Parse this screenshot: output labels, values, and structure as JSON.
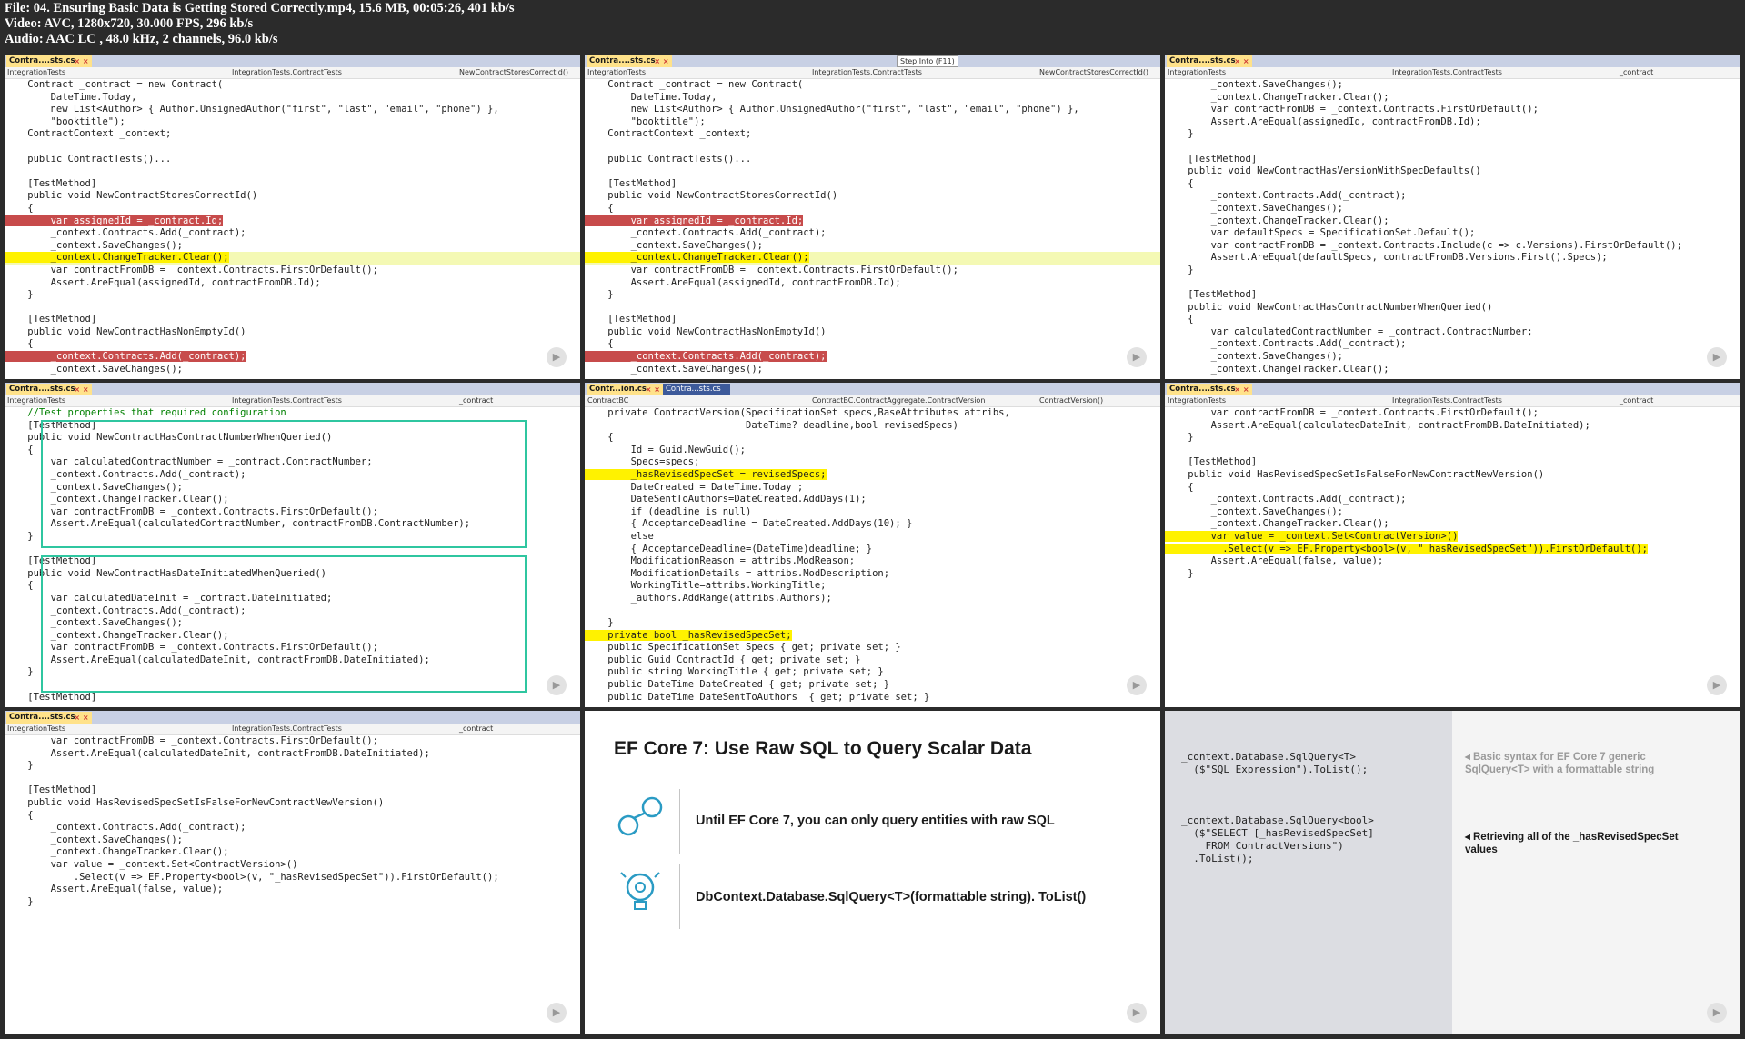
{
  "header": {
    "file": "File: 04. Ensuring Basic Data is Getting Stored Correctly.mp4, 15.6 MB, 00:05:26, 401 kb/s",
    "video": "Video: AVC, 1280x720, 30.000 FPS, 296 kb/s",
    "audio": "Audio: AAC LC , 48.0 kHz, 2 channels, 96.0 kb/s"
  },
  "panel1": {
    "tab": "Contra....sts.cs",
    "nav": [
      "IntegrationTests",
      "IntegrationTests.ContractTests",
      "NewContractStoresCorrectId()"
    ],
    "lines": [
      "    Contract _contract = new Contract(",
      "        DateTime.Today,",
      "        new List<Author> { Author.UnsignedAuthor(\"first\", \"last\", \"email\", \"phone\") },",
      "        \"booktitle\");",
      "    ContractContext _context;",
      "",
      "    public ContractTests()...",
      "",
      "    [TestMethod]",
      "    public void NewContractStoresCorrectId()",
      "    {",
      "        var assignedId = _contract.Id;",
      "        _context.Contracts.Add(_contract);",
      "        _context.SaveChanges();",
      "        _context.ChangeTracker.Clear();",
      "        var contractFromDB = _context.Contracts.FirstOrDefault();",
      "        Assert.AreEqual(assignedId, contractFromDB.Id);",
      "    }",
      "",
      "    [TestMethod]",
      "    public void NewContractHasNonEmptyId()",
      "    {",
      "        _context.Contracts.Add(_contract);",
      "        _context.SaveChanges();"
    ]
  },
  "panel2": {
    "tab": "Contra....sts.cs",
    "tooltip": "Step Into (F11)",
    "nav": [
      "IntegrationTests",
      "IntegrationTests.ContractTests",
      "NewContractStoresCorrectId()"
    ]
  },
  "panel3": {
    "tab": "Contra....sts.cs",
    "nav": [
      "IntegrationTests",
      "IntegrationTests.ContractTests",
      "_contract"
    ],
    "lines": [
      "        _context.SaveChanges();",
      "        _context.ChangeTracker.Clear();",
      "        var contractFromDB = _context.Contracts.FirstOrDefault();",
      "        Assert.AreEqual(assignedId, contractFromDB.Id);",
      "    }",
      "",
      "    [TestMethod]",
      "    public void NewContractHasVersionWithSpecDefaults()",
      "    {",
      "        _context.Contracts.Add(_contract);",
      "        _context.SaveChanges();",
      "        _context.ChangeTracker.Clear();",
      "        var defaultSpecs = SpecificationSet.Default();",
      "        var contractFromDB = _context.Contracts.Include(c => c.Versions).FirstOrDefault();",
      "        Assert.AreEqual(defaultSpecs, contractFromDB.Versions.First().Specs);",
      "    }",
      "",
      "    [TestMethod]",
      "    public void NewContractHasContractNumberWhenQueried()",
      "    {",
      "        var calculatedContractNumber = _contract.ContractNumber;",
      "        _context.Contracts.Add(_contract);",
      "        _context.SaveChanges();",
      "        _context.ChangeTracker.Clear();"
    ]
  },
  "panel4": {
    "tab": "Contra....sts.cs",
    "nav": [
      "IntegrationTests",
      "IntegrationTests.ContractTests",
      "_contract"
    ],
    "lines": [
      "    //Test properties that required configuration",
      "    [TestMethod]",
      "    public void NewContractHasContractNumberWhenQueried()",
      "    {",
      "        var calculatedContractNumber = _contract.ContractNumber;",
      "        _context.Contracts.Add(_contract);",
      "        _context.SaveChanges();",
      "        _context.ChangeTracker.Clear();",
      "        var contractFromDB = _context.Contracts.FirstOrDefault();",
      "        Assert.AreEqual(calculatedContractNumber, contractFromDB.ContractNumber);",
      "    }",
      "",
      "    [TestMethod]",
      "    public void NewContractHasDateInitiatedWhenQueried()",
      "    {",
      "        var calculatedDateInit = _contract.DateInitiated;",
      "        _context.Contracts.Add(_contract);",
      "        _context.SaveChanges();",
      "        _context.ChangeTracker.Clear();",
      "        var contractFromDB = _context.Contracts.FirstOrDefault();",
      "        Assert.AreEqual(calculatedDateInit, contractFromDB.DateInitiated);",
      "    }",
      "",
      "    [TestMethod]"
    ]
  },
  "panel5": {
    "tab": "Contr...ion.cs",
    "tab2": "Contra...sts.cs",
    "nav": [
      "ContractBC",
      "ContractBC.ContractAggregate.ContractVersion",
      "ContractVersion()"
    ],
    "lines": [
      "    private ContractVersion(SpecificationSet specs,BaseAttributes attribs,",
      "                            DateTime? deadline,bool revisedSpecs)",
      "    {",
      "        Id = Guid.NewGuid();",
      "        Specs=specs;",
      "        _hasRevisedSpecSet = revisedSpecs;",
      "        DateCreated = DateTime.Today ;",
      "        DateSentToAuthors=DateCreated.AddDays(1);",
      "        if (deadline is null)",
      "        { AcceptanceDeadline = DateCreated.AddDays(10); }",
      "        else",
      "        { AcceptanceDeadline=(DateTime)deadline; }",
      "        ModificationReason = attribs.ModReason;",
      "        ModificationDetails = attribs.ModDescription;",
      "        WorkingTitle=attribs.WorkingTitle;",
      "        _authors.AddRange(attribs.Authors);",
      "",
      "    }",
      "    private bool _hasRevisedSpecSet;",
      "    public SpecificationSet Specs { get; private set; }",
      "    public Guid ContractId { get; private set; }",
      "    public string WorkingTitle { get; private set; }",
      "    public DateTime DateCreated { get; private set; }",
      "    public DateTime DateSentToAuthors  { get; private set; }"
    ]
  },
  "panel6": {
    "tab": "Contra....sts.cs",
    "nav": [
      "IntegrationTests",
      "IntegrationTests.ContractTests",
      "_contract"
    ],
    "lines": [
      "        var contractFromDB = _context.Contracts.FirstOrDefault();",
      "        Assert.AreEqual(calculatedDateInit, contractFromDB.DateInitiated);",
      "    }",
      "",
      "    [TestMethod]",
      "    public void HasRevisedSpecSetIsFalseForNewContractNewVersion()",
      "    {",
      "        _context.Contracts.Add(_contract);",
      "        _context.SaveChanges();",
      "        _context.ChangeTracker.Clear();",
      "        var value = _context.Set<ContractVersion>()",
      "          .Select(v => EF.Property<bool>(v, \"_hasRevisedSpecSet\")).FirstOrDefault();",
      "        Assert.AreEqual(false, value);",
      "    }"
    ]
  },
  "panel7": {
    "tab": "Contra....sts.cs",
    "nav": [
      "IntegrationTests",
      "IntegrationTests.ContractTests",
      "_contract"
    ],
    "lines": [
      "        var contractFromDB = _context.Contracts.FirstOrDefault();",
      "        Assert.AreEqual(calculatedDateInit, contractFromDB.DateInitiated);",
      "    }",
      "",
      "    [TestMethod]",
      "    public void HasRevisedSpecSetIsFalseForNewContractNewVersion()",
      "    {",
      "        _context.Contracts.Add(_contract);",
      "        _context.SaveChanges();",
      "        _context.ChangeTracker.Clear();",
      "        var value = _context.Set<ContractVersion>()",
      "            .Select(v => EF.Property<bool>(v, \"_hasRevisedSpecSet\")).FirstOrDefault();",
      "        Assert.AreEqual(false, value);",
      "    }"
    ]
  },
  "slide": {
    "title": "EF Core 7: Use Raw SQL to Query Scalar Data",
    "point1": "Until EF Core 7, you can only query entities with raw SQL",
    "point2": "DbContext.Database.SqlQuery<T>(formattable string). ToList()"
  },
  "sqlpanel": {
    "code1": "_context.Database.SqlQuery<T>\n  ($\"SQL Expression\").ToList();",
    "code2": "_context.Database.SqlQuery<bool>\n  ($\"SELECT [_hasRevisedSpecSet]\n    FROM ContractVersions\")\n  .ToList();",
    "note1": "Basic syntax for EF Core 7 generic SqlQuery<T> with a formattable string",
    "note2": "Retrieving all of the _hasRevisedSpecSet values"
  }
}
